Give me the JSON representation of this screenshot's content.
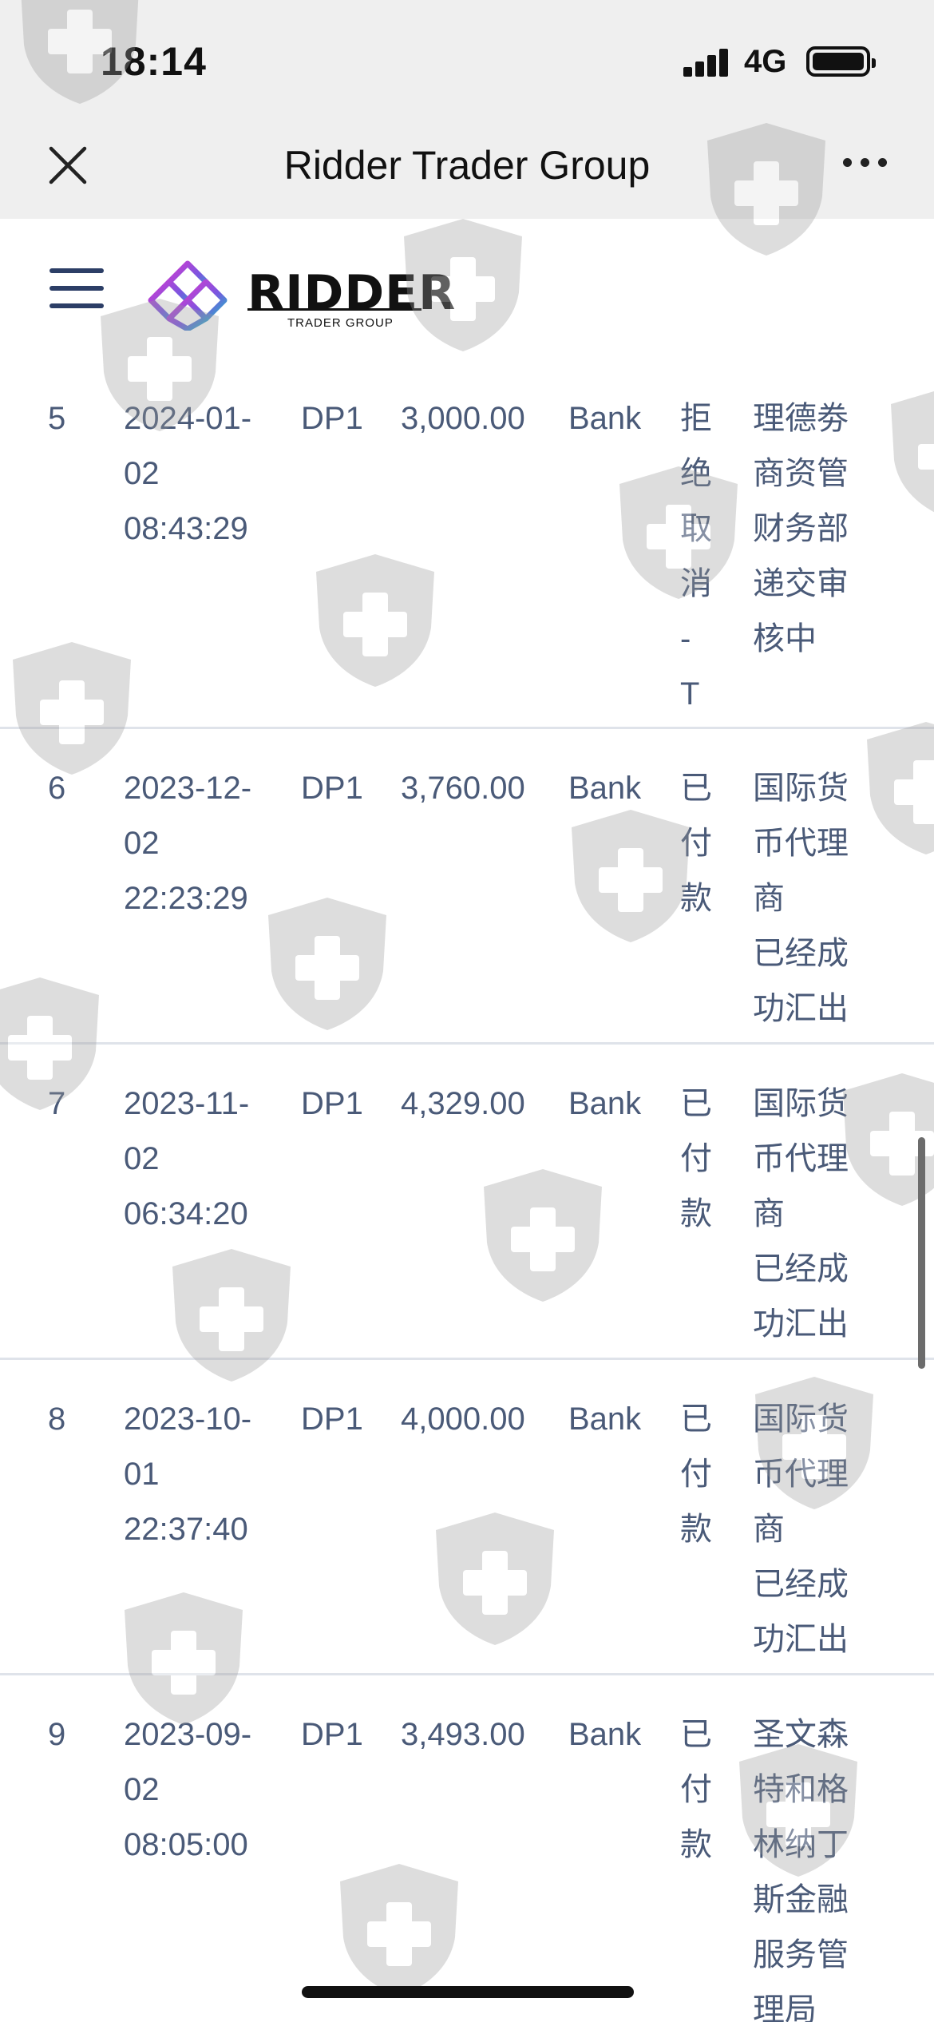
{
  "status_bar": {
    "time": "18:14",
    "network": "4G"
  },
  "nav": {
    "title": "Ridder Trader Group"
  },
  "logo": {
    "word": "RIDDER",
    "sub": "TRADER GROUP"
  },
  "records": [
    {
      "no": "5",
      "date_lines": [
        "2024-01-",
        "02",
        "08:43:29"
      ],
      "code": "DP1",
      "amount": "3,000.00",
      "method": "Bank",
      "status_lines": [
        "拒",
        "绝",
        "取",
        "消",
        "-",
        "T"
      ],
      "note_lines": [
        "理德劵",
        "商资管",
        "财务部",
        "递交审",
        "核中"
      ]
    },
    {
      "no": "6",
      "date_lines": [
        "2023-12-",
        "02",
        "22:23:29"
      ],
      "code": "DP1",
      "amount": "3,760.00",
      "method": "Bank",
      "status_lines": [
        "已",
        "付",
        "款"
      ],
      "note_lines": [
        "国际货",
        "币代理",
        "商",
        "已经成",
        "功汇出"
      ]
    },
    {
      "no": "7",
      "date_lines": [
        "2023-11-",
        "02",
        "06:34:20"
      ],
      "code": "DP1",
      "amount": "4,329.00",
      "method": "Bank",
      "status_lines": [
        "已",
        "付",
        "款"
      ],
      "note_lines": [
        "国际货",
        "币代理",
        "商",
        "已经成",
        "功汇出"
      ]
    },
    {
      "no": "8",
      "date_lines": [
        "2023-10-",
        "01",
        "22:37:40"
      ],
      "code": "DP1",
      "amount": "4,000.00",
      "method": "Bank",
      "status_lines": [
        "已",
        "付",
        "款"
      ],
      "note_lines": [
        "国际货",
        "币代理",
        "商",
        "已经成",
        "功汇出"
      ]
    },
    {
      "no": "9",
      "date_lines": [
        "2023-09-",
        "02",
        "08:05:00"
      ],
      "code": "DP1",
      "amount": "3,493.00",
      "method": "Bank",
      "status_lines": [
        "已",
        "付",
        "款"
      ],
      "note_lines": [
        "圣文森",
        "特和格",
        "林纳丁",
        "斯金融",
        "服务管",
        "理局"
      ]
    }
  ]
}
